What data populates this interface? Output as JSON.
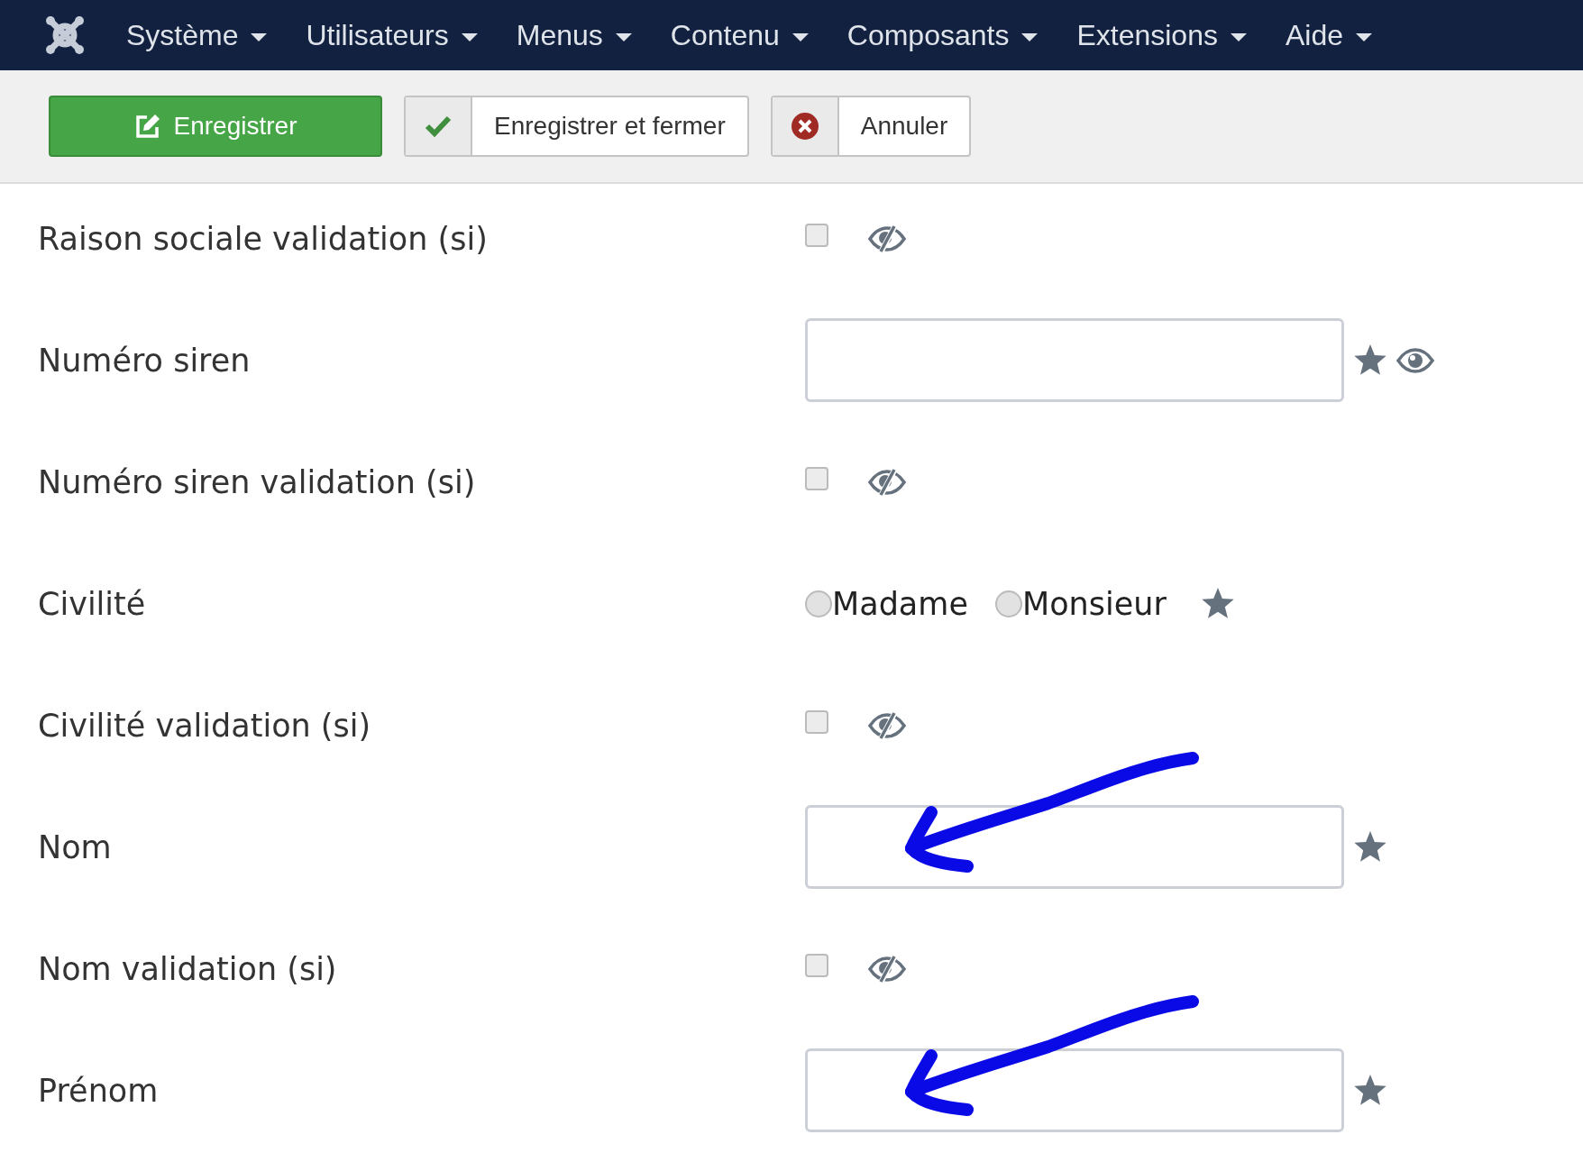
{
  "navbar": {
    "menus": [
      {
        "label": "Système"
      },
      {
        "label": "Utilisateurs"
      },
      {
        "label": "Menus"
      },
      {
        "label": "Contenu"
      },
      {
        "label": "Composants"
      },
      {
        "label": "Extensions"
      },
      {
        "label": "Aide"
      }
    ]
  },
  "toolbar": {
    "buttons": [
      {
        "kind": "save",
        "label": "Enregistrer"
      },
      {
        "kind": "save-close",
        "label": "Enregistrer et fermer"
      },
      {
        "kind": "cancel",
        "label": "Annuler"
      }
    ]
  },
  "form": {
    "rows": [
      {
        "label": "Raison sociale validation (si)",
        "kind": "checkbox",
        "checked": false,
        "required": false,
        "visible": false,
        "arrow": false
      },
      {
        "label": "Numéro siren",
        "kind": "text",
        "required": true,
        "visible": true,
        "arrow": false
      },
      {
        "label": "Numéro siren validation (si)",
        "kind": "checkbox",
        "checked": false,
        "required": false,
        "visible": false,
        "arrow": false
      },
      {
        "label": "Civilité",
        "kind": "radio",
        "options": [
          {
            "label": "Madame",
            "selected": false
          },
          {
            "label": "Monsieur",
            "selected": false
          }
        ],
        "required": true,
        "arrow": false
      },
      {
        "label": "Civilité validation (si)",
        "kind": "checkbox",
        "checked": false,
        "required": false,
        "visible": false,
        "arrow": false
      },
      {
        "label": "Nom",
        "kind": "text",
        "required": true,
        "arrow": true
      },
      {
        "label": "Nom validation (si)",
        "kind": "checkbox",
        "checked": false,
        "required": false,
        "visible": false,
        "arrow": false
      },
      {
        "label": "Prénom",
        "kind": "text",
        "required": true,
        "arrow": true
      }
    ]
  }
}
